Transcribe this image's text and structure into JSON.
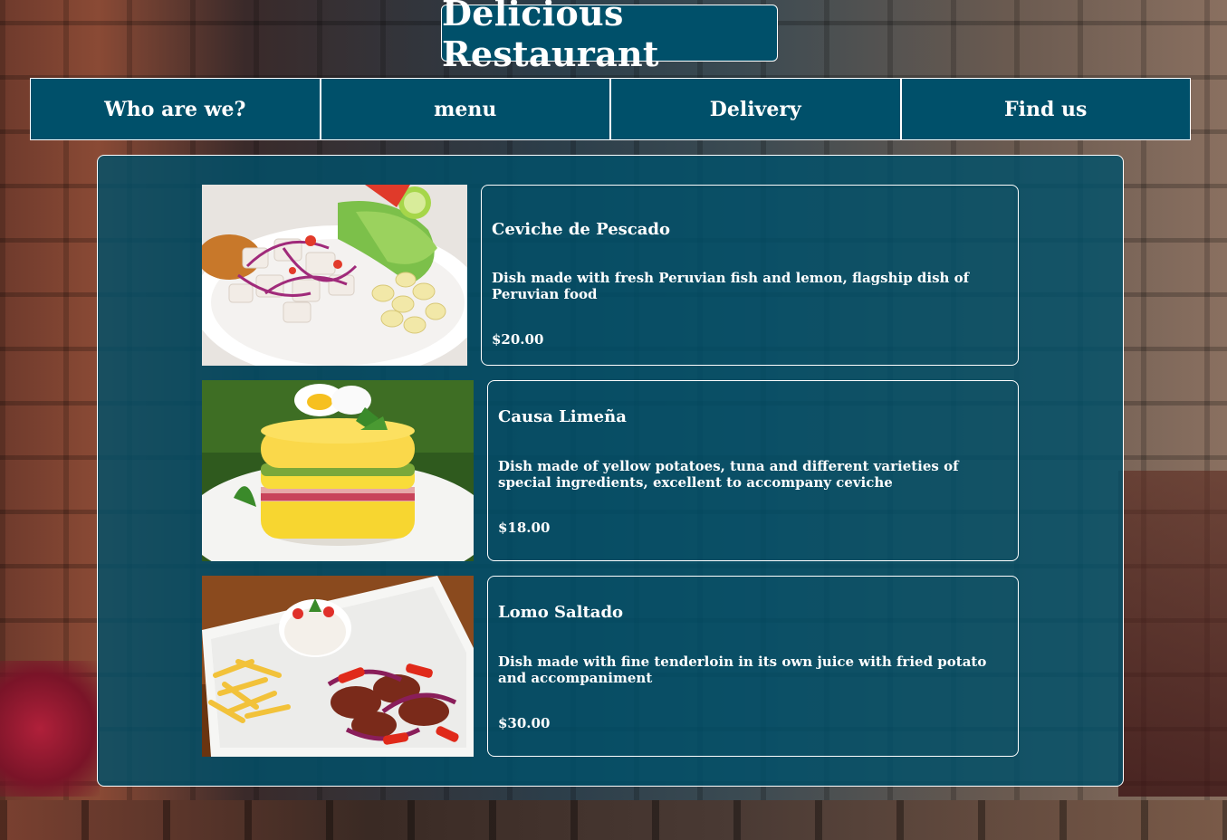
{
  "header": {
    "title": "Delicious Restaurant"
  },
  "nav": {
    "items": [
      {
        "label": "Who are we?"
      },
      {
        "label": "menu"
      },
      {
        "label": "Delivery"
      },
      {
        "label": "Find us"
      }
    ]
  },
  "menu": {
    "dishes": [
      {
        "name": "Ceviche de Pescado",
        "description": "Dish made with fresh Peruvian fish and lemon, flagship dish of Peruvian food",
        "price": "$20.00",
        "image_icon": "ceviche-photo"
      },
      {
        "name": "Causa Limeña",
        "description": "Dish made of yellow potatoes, tuna and different varieties of special ingredients, excellent to accompany ceviche",
        "price": "$18.00",
        "image_icon": "causa-photo"
      },
      {
        "name": "Lomo Saltado",
        "description": "Dish made with fine tenderloin in its own juice with fried potato and accompaniment",
        "price": "$30.00",
        "image_icon": "lomo-saltado-photo"
      }
    ]
  },
  "colors": {
    "primary": "#00506a",
    "border": "#ffffff",
    "text": "#ffffff"
  }
}
